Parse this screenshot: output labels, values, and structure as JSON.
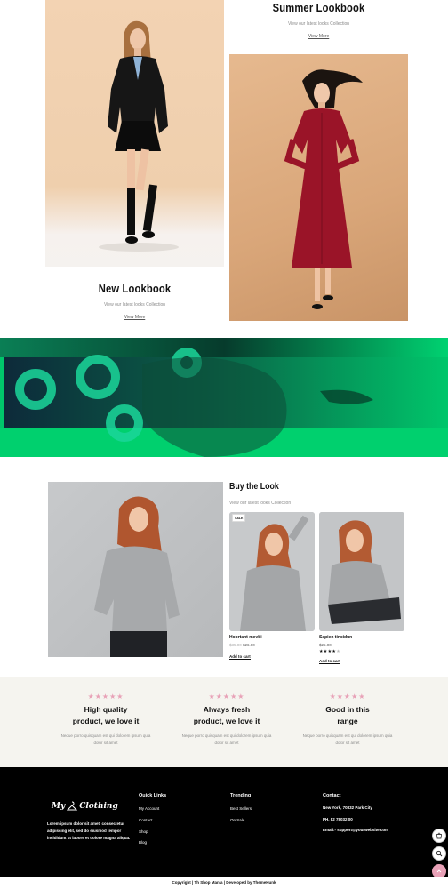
{
  "lookbooks": {
    "new": {
      "title": "New Lookbook",
      "subtitle": "View our latest looks Collection",
      "link": "View More"
    },
    "summer": {
      "title": "Summer Lookbook",
      "subtitle": "View our latest looks Collection",
      "link": "View More"
    }
  },
  "buy_look": {
    "title": "Buy the Look",
    "subtitle": "View our latest looks Collection",
    "products": [
      {
        "badge": "SALE",
        "name": "Hobrtant mevbi",
        "old_price": "$35.00",
        "price": "$26.00",
        "cta": "Add to cart",
        "rating": 0
      },
      {
        "badge": "",
        "name": "Sapien tincidun",
        "old_price": "",
        "price": "$25.00",
        "cta": "Add to cart",
        "rating": 4
      }
    ]
  },
  "features": [
    {
      "stars": "★★★★★",
      "title_line1": "High quality",
      "title_line2": "product, we love it",
      "text_line1": "Neque porro quisquam est qui dolorem ipsum quia",
      "text_line2": "dolor sit amet"
    },
    {
      "stars": "★★★★★",
      "title_line1": "Always fresh",
      "title_line2": "product, we love it",
      "text_line1": "Neque porro quisquam est qui dolorem ipsum quia",
      "text_line2": "dolor sit amet"
    },
    {
      "stars": "★★★★★",
      "title_line1": "Good in this",
      "title_line2": "range",
      "text_line1": "Neque porro quisquam est qui dolorem ipsum quia",
      "text_line2": "dolor sit amet"
    }
  ],
  "footer": {
    "logo_left": "My",
    "logo_right": "Clothing",
    "about_lines": [
      "Lorem ipsum dolor sit amet, consectetur",
      "adipiscing elit, sed do eiusmod tempor",
      "incididunt ut labore et dolore magna aliqua."
    ],
    "quick_links": {
      "heading": "Quick Links",
      "items": [
        "My Account",
        "Contact",
        "Shop",
        "Blog"
      ]
    },
    "trending": {
      "heading": "Trending",
      "items": [
        "Best Sellers",
        "On Sale"
      ]
    },
    "contact": {
      "heading": "Contact",
      "address": "New York, 70832 Park City",
      "phone": "PH. 82 78032 00",
      "email": "Email:- support@yourwebsite.com"
    },
    "copyright": "Copyright | Th Shop Mania | Developed by ThemeHunk"
  },
  "colors": {
    "accent_pink": "#e8a1b7",
    "banner_green": "#00c66b",
    "footer_bg": "#000000",
    "feature_bg": "#f5f4ef"
  },
  "icons": {
    "cart": "cart-icon",
    "search": "search-icon",
    "scroll_top": "arrow-up-icon"
  }
}
